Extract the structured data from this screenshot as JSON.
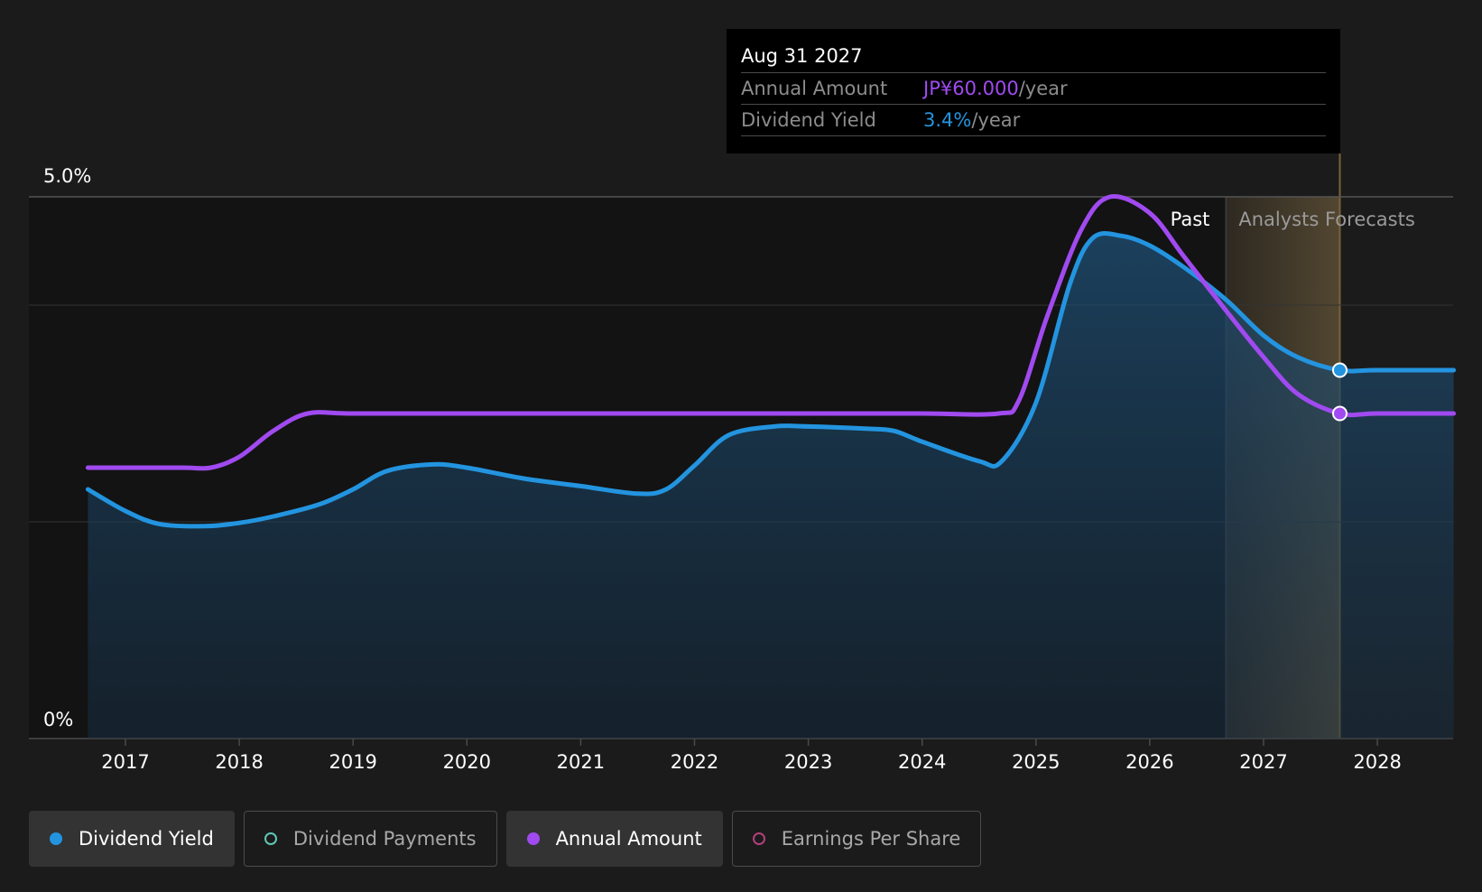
{
  "colors": {
    "background": "#1b1b1b",
    "plot_past_background": "#131313",
    "dividend_yield": "#2394df",
    "annual_amount": "#a04af0",
    "dividend_payments": "#5fc8b6",
    "earnings_per_share": "#b2417a",
    "forecast_band": "#6b5a3a"
  },
  "tooltip": {
    "date": "Aug 31 2027",
    "rows": [
      {
        "label": "Annual Amount",
        "value": "JP¥60.000",
        "unit": "/year",
        "color": "#a04af0"
      },
      {
        "label": "Dividend Yield",
        "value": "3.4%",
        "unit": "/year",
        "color": "#2394df"
      }
    ]
  },
  "regions": {
    "past_label": "Past",
    "forecast_label": "Analysts Forecasts"
  },
  "legend": [
    {
      "label": "Dividend Yield",
      "active": true,
      "color": "#2394df",
      "filled": true,
      "icon": "dividend-yield-dot"
    },
    {
      "label": "Dividend Payments",
      "active": false,
      "color": "#5fc8b6",
      "filled": false,
      "icon": "dividend-payments-ring"
    },
    {
      "label": "Annual Amount",
      "active": true,
      "color": "#a04af0",
      "filled": true,
      "icon": "annual-amount-dot"
    },
    {
      "label": "Earnings Per Share",
      "active": false,
      "color": "#b2417a",
      "filled": false,
      "icon": "earnings-per-share-ring"
    }
  ],
  "chart_data": {
    "type": "line",
    "title": "",
    "xlabel": "",
    "ylabel": "",
    "ylim": [
      0,
      5.0
    ],
    "y_tick_labels": [
      "0%",
      "5.0%"
    ],
    "x_ticks": [
      "2017",
      "2018",
      "2019",
      "2020",
      "2021",
      "2022",
      "2023",
      "2024",
      "2025",
      "2026",
      "2027",
      "2028"
    ],
    "xlim": [
      2016.17,
      2028.67
    ],
    "past_end": 2026.67,
    "forecast_end": 2027.67,
    "grid": true,
    "legend_position": "bottom",
    "series": [
      {
        "name": "Dividend Yield",
        "area": true,
        "points": [
          [
            2016.67,
            2.3
          ],
          [
            2017.0,
            2.1
          ],
          [
            2017.3,
            1.98
          ],
          [
            2017.7,
            1.96
          ],
          [
            2018.0,
            1.99
          ],
          [
            2018.3,
            2.05
          ],
          [
            2018.7,
            2.16
          ],
          [
            2019.0,
            2.3
          ],
          [
            2019.3,
            2.47
          ],
          [
            2019.7,
            2.53
          ],
          [
            2020.0,
            2.5
          ],
          [
            2020.5,
            2.4
          ],
          [
            2021.0,
            2.33
          ],
          [
            2021.5,
            2.26
          ],
          [
            2021.75,
            2.3
          ],
          [
            2022.0,
            2.52
          ],
          [
            2022.3,
            2.8
          ],
          [
            2022.7,
            2.88
          ],
          [
            2023.0,
            2.88
          ],
          [
            2023.5,
            2.86
          ],
          [
            2023.75,
            2.84
          ],
          [
            2024.0,
            2.74
          ],
          [
            2024.5,
            2.56
          ],
          [
            2024.7,
            2.56
          ],
          [
            2025.0,
            3.1
          ],
          [
            2025.3,
            4.2
          ],
          [
            2025.5,
            4.62
          ],
          [
            2025.75,
            4.64
          ],
          [
            2026.0,
            4.55
          ],
          [
            2026.3,
            4.35
          ],
          [
            2026.67,
            4.05
          ],
          [
            2027.0,
            3.72
          ],
          [
            2027.3,
            3.52
          ],
          [
            2027.67,
            3.4
          ],
          [
            2028.0,
            3.4
          ],
          [
            2028.67,
            3.4
          ]
        ],
        "marker_at": 2027.67
      },
      {
        "name": "Annual Amount",
        "area": false,
        "points": [
          [
            2016.67,
            2.5
          ],
          [
            2017.0,
            2.5
          ],
          [
            2017.5,
            2.5
          ],
          [
            2017.75,
            2.5
          ],
          [
            2018.0,
            2.6
          ],
          [
            2018.3,
            2.84
          ],
          [
            2018.6,
            3.0
          ],
          [
            2019.0,
            3.0
          ],
          [
            2020.0,
            3.0
          ],
          [
            2021.0,
            3.0
          ],
          [
            2022.0,
            3.0
          ],
          [
            2023.0,
            3.0
          ],
          [
            2024.0,
            3.0
          ],
          [
            2024.67,
            3.0
          ],
          [
            2024.85,
            3.12
          ],
          [
            2025.1,
            3.9
          ],
          [
            2025.4,
            4.7
          ],
          [
            2025.65,
            5.0
          ],
          [
            2026.0,
            4.85
          ],
          [
            2026.3,
            4.45
          ],
          [
            2026.67,
            3.95
          ],
          [
            2027.0,
            3.52
          ],
          [
            2027.3,
            3.18
          ],
          [
            2027.67,
            3.0
          ],
          [
            2028.0,
            3.0
          ],
          [
            2028.67,
            3.0
          ]
        ],
        "marker_at": 2027.67
      }
    ]
  }
}
